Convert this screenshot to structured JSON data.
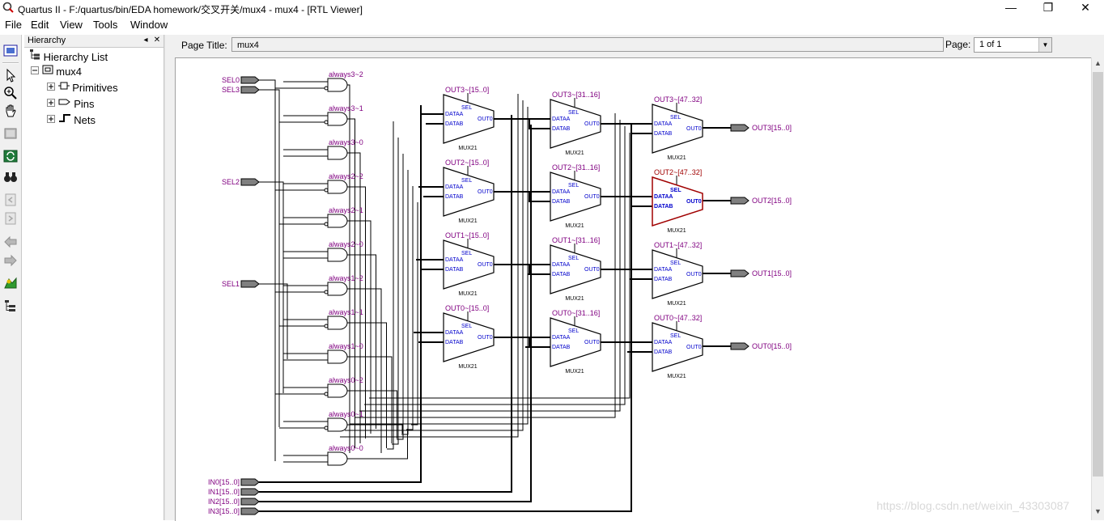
{
  "window": {
    "title": "Quartus II - F:/quartus/bin/EDA homework/交叉开关/mux4 - mux4 - [RTL Viewer]",
    "controls": [
      "—",
      "❐",
      "✕"
    ]
  },
  "menu": [
    "File",
    "Edit",
    "View",
    "Tools",
    "Window"
  ],
  "toolbar": {
    "icons": [
      "rtl-viewer-icon",
      "select-icon",
      "zoom-icon",
      "hand-icon",
      "fit-icon",
      "refresh-icon",
      "binoculars-icon",
      "back-page-icon",
      "forward-page-icon",
      "back-icon",
      "forward-icon",
      "netlist-icon",
      "hierarchy-icon"
    ]
  },
  "hierarchy": {
    "title": "Hierarchy",
    "buttons": [
      "◂",
      "✕"
    ],
    "root_label": "Hierarchy List",
    "module": "mux4",
    "children": [
      "Primitives",
      "Pins",
      "Nets"
    ]
  },
  "viewer": {
    "page_title_label": "Page Title:",
    "page_title_value": "mux4",
    "page_label": "Page:",
    "page_value": "1 of 1"
  },
  "schematic": {
    "sel_inputs": [
      "SEL0",
      "SEL3",
      "SEL2",
      "SEL1"
    ],
    "in_inputs": [
      "IN0[15..0]",
      "IN1[15..0]",
      "IN2[15..0]",
      "IN3[15..0]"
    ],
    "and_gates": [
      "always3~2",
      "always3~1",
      "always3~0",
      "always2~2",
      "always2~1",
      "always2~0",
      "always1~2",
      "always1~1",
      "always1~0",
      "always0~2",
      "always0~1",
      "always0~0"
    ],
    "mux_cols": [
      [
        "OUT3~[15..0]",
        "OUT2~[15..0]",
        "OUT1~[15..0]",
        "OUT0~[15..0]"
      ],
      [
        "OUT3~[31..16]",
        "OUT2~[31..16]",
        "OUT1~[31..16]",
        "OUT0~[31..16]"
      ],
      [
        "OUT3~[47..32]",
        "OUT2~[47..32]",
        "OUT1~[47..32]",
        "OUT0~[47..32]"
      ]
    ],
    "mux_type": "MUX21",
    "mux_pins": {
      "sel": "SEL",
      "a": "DATAA",
      "b": "DATAB",
      "out": "OUT0"
    },
    "outputs": [
      "OUT3[15..0]",
      "OUT2[15..0]",
      "OUT1[15..0]",
      "OUT0[15..0]"
    ],
    "highlighted": "OUT2~[47..32]"
  },
  "colors": {
    "label": "#800080",
    "pin_text": "#0000cc",
    "highlight": "#a00000",
    "pin_fill": "#808080"
  },
  "watermark": "https://blog.csdn.net/weixin_43303087"
}
